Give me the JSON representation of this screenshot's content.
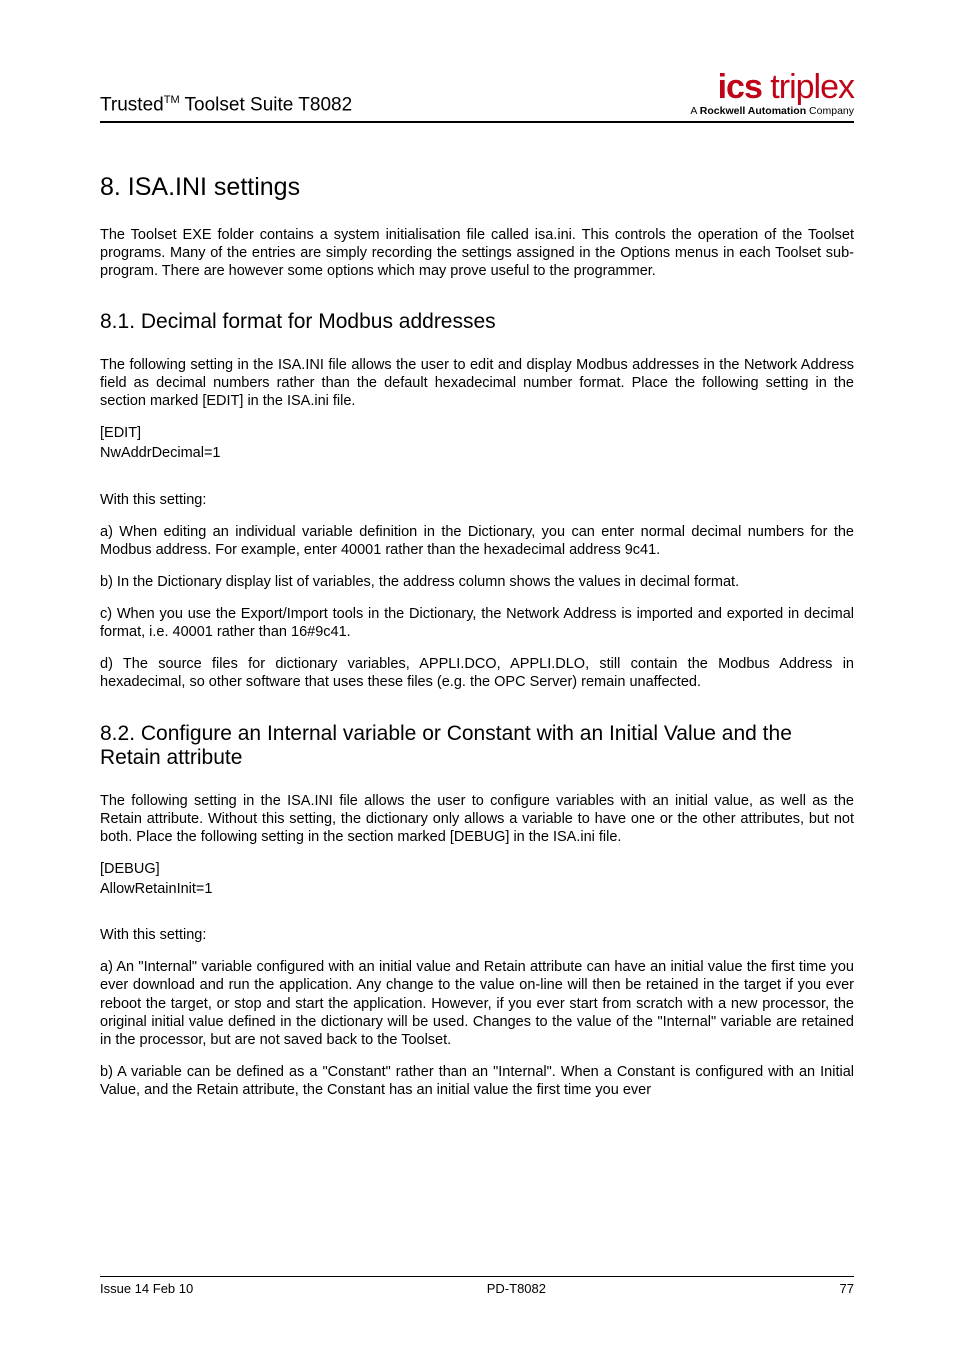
{
  "header": {
    "product_left": "Trusted",
    "tm": "TM",
    "product_right": " Toolset Suite T8082",
    "logo_main_bold": "ics",
    "logo_main_rest": " triplex",
    "logo_sub_prefix": "A ",
    "logo_sub_bold": "Rockwell Automation",
    "logo_sub_suffix": " Company"
  },
  "h1": "8. ISA.INI settings",
  "intro": "The Toolset EXE folder contains a system initialisation file called isa.ini. This controls the operation of the Toolset programs. Many of the entries are simply recording the settings assigned in the Options menus in each Toolset sub-program. There are however some options which may prove useful to the programmer.",
  "s81": {
    "title": "8.1. Decimal format for Modbus addresses",
    "p1": "The following setting in the ISA.INI file allows the user to edit and display Modbus addresses in the Network Address field as decimal numbers rather than the default hexadecimal number format. Place the following setting in the section marked [EDIT] in the ISA.ini file.",
    "cfg1": "[EDIT]",
    "cfg2": "NwAddrDecimal=1",
    "with": "With this setting:",
    "a": "a) When editing an individual variable definition in the Dictionary, you can enter normal decimal numbers for the Modbus address.  For example, enter 40001 rather than the hexadecimal address 9c41.",
    "b": "b) In the Dictionary display list of variables, the address column shows the values in decimal format.",
    "c": "c) When you use the Export/Import tools in the Dictionary, the Network Address is imported and exported in decimal format, i.e. 40001 rather than 16#9c41.",
    "d": "d) The source files for dictionary variables, APPLI.DCO, APPLI.DLO, still contain the Modbus Address in hexadecimal, so other software that uses these files (e.g. the OPC Server) remain unaffected."
  },
  "s82": {
    "title": "8.2. Configure an Internal variable or Constant with an Initial Value and the Retain attribute",
    "p1": "The following setting in the ISA.INI file allows the user to configure variables with an initial value, as well as the Retain attribute.  Without this setting, the dictionary only allows a variable to have one or the other attributes, but not both. Place the following setting in the section marked [DEBUG] in the ISA.ini file.",
    "cfg1": "[DEBUG]",
    "cfg2": "AllowRetainInit=1",
    "with": "With this setting:",
    "a": "a) An \"Internal\" variable configured with an initial value and Retain attribute can have an initial value the first time you ever download and run the application.  Any change to the value on-line will then be retained in the target if you ever reboot the target, or stop and start the application.  However, if you ever start from scratch with a new processor, the original initial value defined in the dictionary will be used.  Changes to the value of the \"Internal\" variable are retained in the processor, but are not saved back to the Toolset.",
    "b": "b) A variable can be defined as a \"Constant\" rather than an \"Internal\". When a Constant is configured with an Initial Value, and the Retain attribute, the Constant has an initial value the first time you ever"
  },
  "footer": {
    "left": "Issue 14 Feb 10",
    "center": "PD-T8082",
    "right": "77"
  }
}
